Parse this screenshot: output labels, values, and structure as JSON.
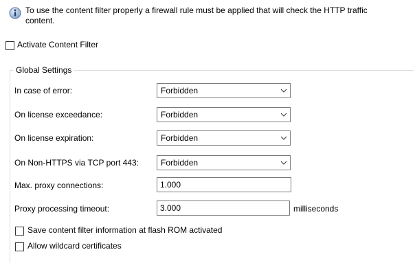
{
  "info": {
    "icon": "info-icon",
    "text": "To use the content filter properly a firewall rule must be applied that will check the HTTP traffic content."
  },
  "activate": {
    "label": "Activate Content Filter",
    "checked": false
  },
  "global_settings": {
    "title": "Global Settings",
    "rows": [
      {
        "label": "In case of error:",
        "value": "Forbidden"
      },
      {
        "label": "On license exceedance:",
        "value": "Forbidden"
      },
      {
        "label": "On license expiration:",
        "value": "Forbidden"
      },
      {
        "label": "On Non-HTTPS via TCP port 443:",
        "value": "Forbidden"
      }
    ],
    "max_connections": {
      "label": "Max. proxy connections:",
      "value": "1.000"
    },
    "timeout": {
      "label": "Proxy processing timeout:",
      "value": "3.000",
      "unit": "milliseconds"
    },
    "save_flash": {
      "label": "Save content filter information at flash ROM activated",
      "checked": false
    },
    "wildcard": {
      "label": "Allow wildcard certificates",
      "checked": false
    }
  }
}
